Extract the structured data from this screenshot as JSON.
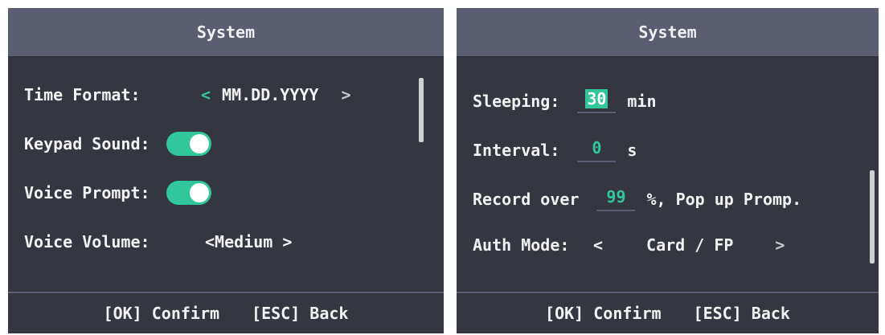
{
  "left_panel": {
    "title": "System",
    "time_format": {
      "label": "Time Format:",
      "value": "MM.DD.YYYY",
      "prev": "<",
      "next": ">"
    },
    "keypad_sound": {
      "label": "Keypad Sound:",
      "on": true
    },
    "voice_prompt": {
      "label": "Voice Prompt:",
      "on": true
    },
    "voice_volume": {
      "label": "Voice Volume:",
      "value": "<Medium >"
    },
    "footer": {
      "ok": "[OK] Confirm",
      "esc": "[ESC] Back"
    }
  },
  "right_panel": {
    "title": "System",
    "sleeping": {
      "label": "Sleeping:",
      "value": "30",
      "unit": "min"
    },
    "interval": {
      "label": "Interval:",
      "value": "0",
      "unit": "s"
    },
    "record_over": {
      "label": "Record over",
      "value": "99",
      "suffix": "%, Pop up Promp."
    },
    "auth_mode": {
      "label": "Auth Mode:",
      "value": "Card / FP",
      "prev": "<",
      "next": ">"
    },
    "footer": {
      "ok": "[OK] Confirm",
      "esc": "[ESC] Back"
    }
  },
  "colors": {
    "accent": "#31c79a",
    "header": "#5a5e70",
    "panel": "#34373f"
  },
  "icons": {
    "prev": "chevron-left-icon",
    "next": "chevron-right-icon"
  }
}
